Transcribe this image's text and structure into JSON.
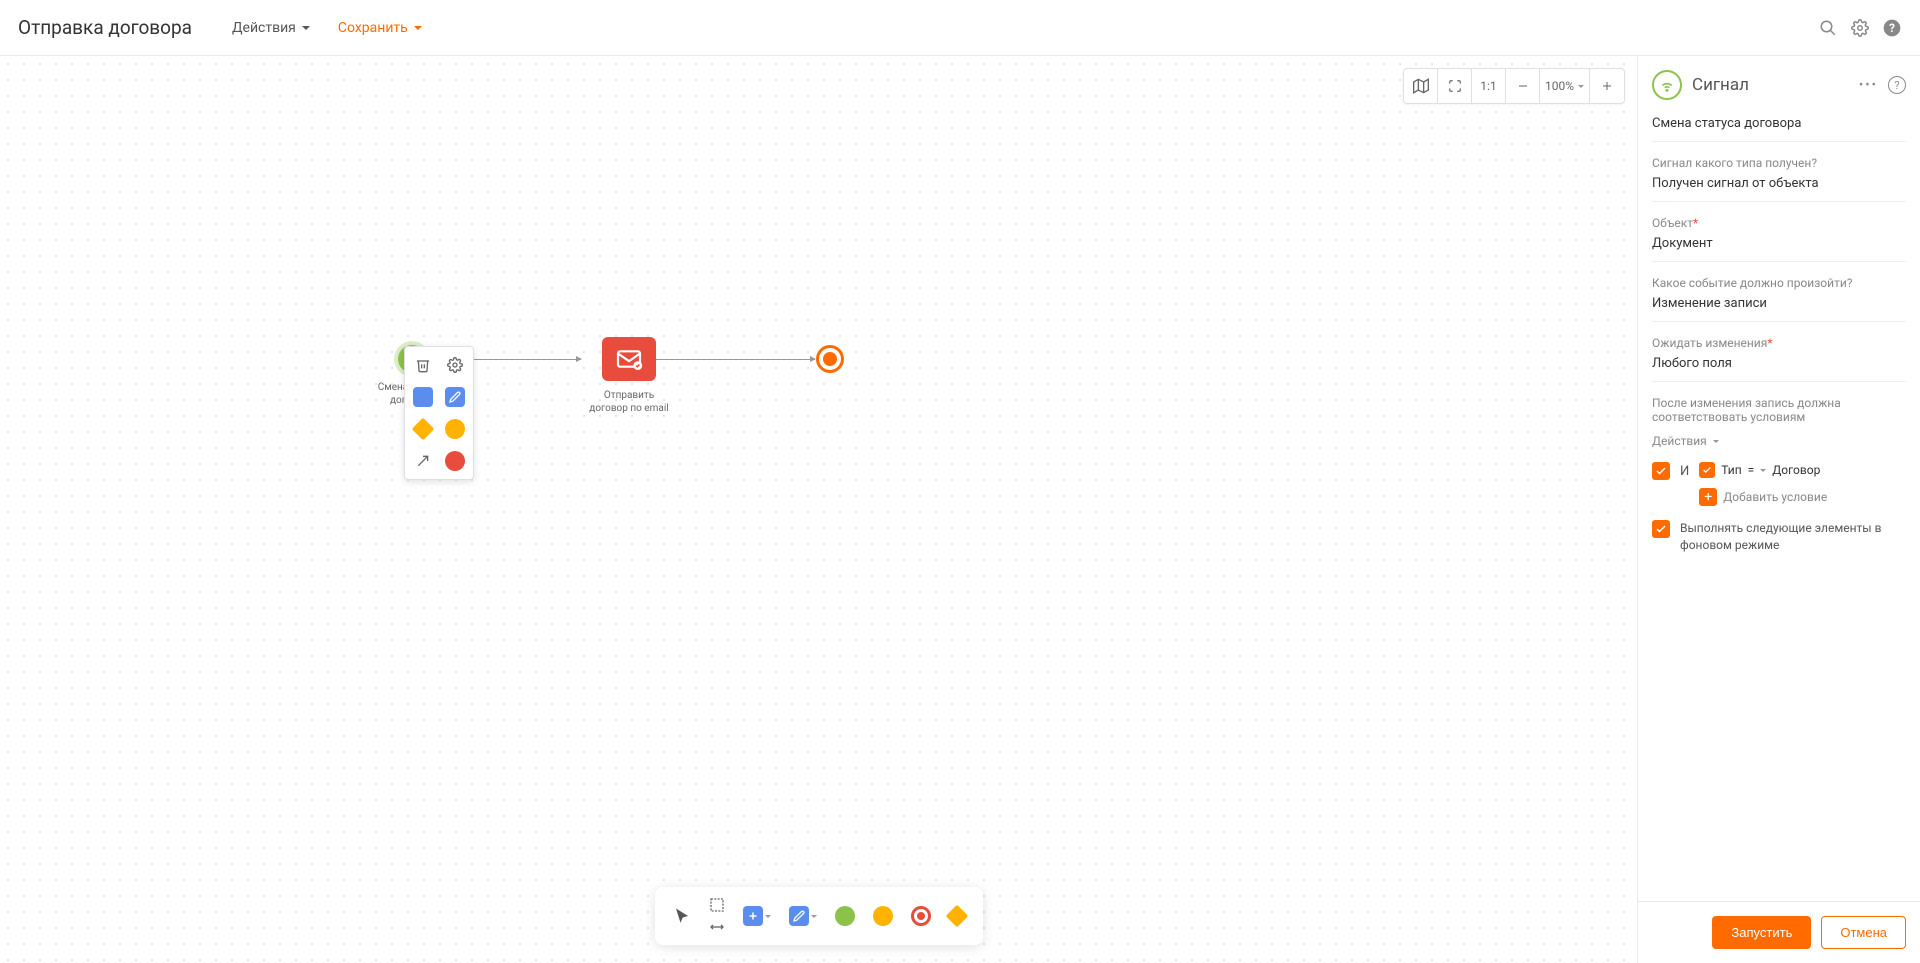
{
  "header": {
    "title": "Отправка договора",
    "menu": {
      "actions": "Действия",
      "save": "Сохранить"
    }
  },
  "canvas_toolbar": {
    "ratio": "1:1",
    "zoom": "100%"
  },
  "nodes": {
    "start_label": "Смена статуса договора",
    "email_label": "Отправить договор по email"
  },
  "panel": {
    "type": "Сигнал",
    "name": "Смена статуса договора",
    "q_signal_type": "Сигнал какого типа получен?",
    "v_signal_type": "Получен сигнал от объекта",
    "q_object": "Объект",
    "v_object": "Документ",
    "q_event": "Какое событие должно произойти?",
    "v_event": "Изменение записи",
    "q_wait": "Ожидать изменения",
    "v_wait": "Любого поля",
    "q_after": "После изменения запись должна соответствовать условиям",
    "actions_label": "Действия",
    "cond_and": "И",
    "cond_field": "Тип",
    "cond_op": "=",
    "cond_value": "Договор",
    "add_cond": "Добавить условие",
    "bg_label": "Выполнять следующие элементы в фоновом режиме"
  },
  "footer": {
    "run": "Запустить",
    "cancel": "Отмена"
  }
}
